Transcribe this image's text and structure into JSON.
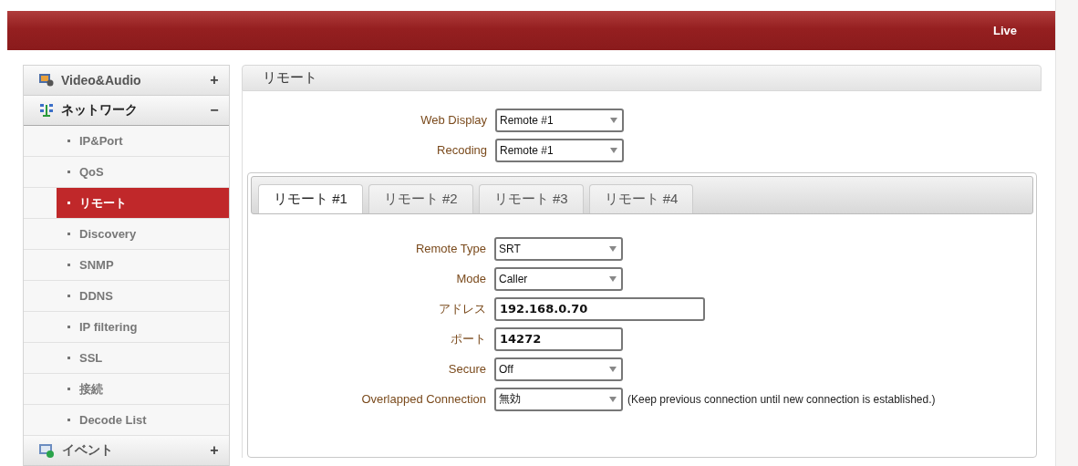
{
  "header": {
    "link": "Live"
  },
  "sidebar": {
    "groups": [
      {
        "label": "Video&Audio",
        "sign": "+",
        "expanded": false
      },
      {
        "label": "ネットワーク",
        "sign": "−",
        "expanded": true,
        "children": [
          {
            "label": "IP&Port",
            "selected": false
          },
          {
            "label": "QoS",
            "selected": false
          },
          {
            "label": "リモート",
            "selected": true
          },
          {
            "label": "Discovery",
            "selected": false
          },
          {
            "label": "SNMP",
            "selected": false
          },
          {
            "label": "DDNS",
            "selected": false
          },
          {
            "label": "IP filtering",
            "selected": false
          },
          {
            "label": "SSL",
            "selected": false
          },
          {
            "label": "接続",
            "selected": false
          },
          {
            "label": "Decode List",
            "selected": false
          }
        ]
      },
      {
        "label": "イベント",
        "sign": "+",
        "expanded": false
      }
    ]
  },
  "panel": {
    "title": "リモート",
    "top_fields": [
      {
        "label": "Web Display",
        "kind": "select",
        "value": "Remote #1"
      },
      {
        "label": "Recoding",
        "kind": "select",
        "value": "Remote #1"
      }
    ],
    "tabs": [
      {
        "label": "リモート #1",
        "selected": true
      },
      {
        "label": "リモート #2",
        "selected": false
      },
      {
        "label": "リモート #3",
        "selected": false
      },
      {
        "label": "リモート #4",
        "selected": false
      }
    ],
    "fields": [
      {
        "label": "Remote Type",
        "kind": "select",
        "value": "SRT"
      },
      {
        "label": "Mode",
        "kind": "select",
        "value": "Caller"
      },
      {
        "label": "アドレス",
        "kind": "input",
        "wide": true,
        "value": "192.168.0.70"
      },
      {
        "label": "ポート",
        "kind": "input",
        "wide": false,
        "value": "14272"
      },
      {
        "label": "Secure",
        "kind": "select",
        "value": "Off"
      },
      {
        "label": "Overlapped Connection",
        "kind": "select",
        "value": "無効",
        "note": "(Keep previous connection until new connection is established.)"
      }
    ]
  }
}
